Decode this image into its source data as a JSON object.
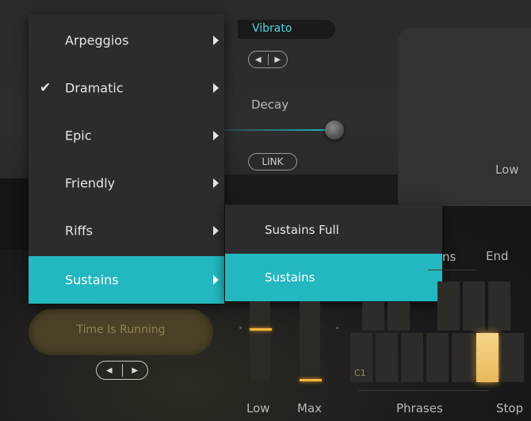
{
  "menu": {
    "items": [
      {
        "label": "Arpeggios",
        "checked": false,
        "active": false
      },
      {
        "label": "Dramatic",
        "checked": true,
        "active": false
      },
      {
        "label": "Epic",
        "checked": false,
        "active": false
      },
      {
        "label": "Friendly",
        "checked": false,
        "active": false
      },
      {
        "label": "Riffs",
        "checked": false,
        "active": false
      },
      {
        "label": "Sustains",
        "checked": false,
        "active": true
      }
    ]
  },
  "submenu": {
    "items": [
      {
        "label": "Sustains Full",
        "active": false
      },
      {
        "label": "Sustains",
        "active": true
      }
    ]
  },
  "controls": {
    "vibrato_label": "Vibrato",
    "decay_label": "Decay",
    "link_label": "LINK",
    "low_right_label": "Low",
    "time_pill_label": "Time Is Running"
  },
  "sequencer": {
    "partial_label": "ns",
    "end_label": "End",
    "c1_label": "C1",
    "low_label": "Low",
    "max_label": "Max",
    "phrases_label": "Phrases",
    "stop_label": "Stop"
  },
  "colors": {
    "accent": "#23b7bf",
    "accent_text": "#4fd2d8",
    "amber": "#f3b73a"
  }
}
